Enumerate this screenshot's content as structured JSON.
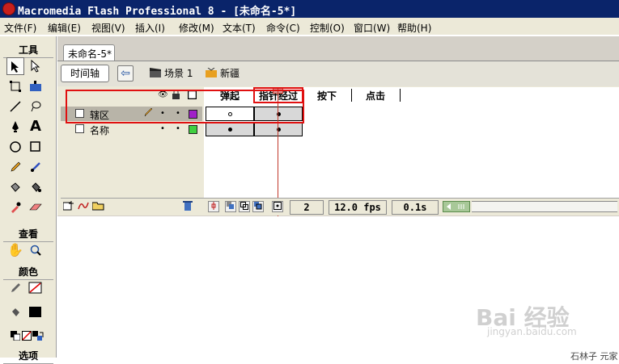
{
  "window": {
    "title": "Macromedia Flash Professional 8 - [未命名-5*]"
  },
  "menu": [
    "文件(F)",
    "编辑(E)",
    "视图(V)",
    "插入(I)",
    "修改(M)",
    "文本(T)",
    "命令(C)",
    "控制(O)",
    "窗口(W)",
    "帮助(H)"
  ],
  "tools": {
    "section_tools": "工具",
    "section_view": "查看",
    "section_colors": "颜色",
    "section_options": "选项"
  },
  "document": {
    "tab": "未命名-5*",
    "timeline_button": "时间轴",
    "scene": "场景 1",
    "symbol": "新疆"
  },
  "timeline": {
    "frame_headers": [
      "弹起",
      "指针经过",
      "按下",
      "点击"
    ],
    "layers": [
      {
        "name": "辖区",
        "selected": true,
        "color": "#a020c8"
      },
      {
        "name": "名称",
        "selected": false,
        "color": "#40d040"
      }
    ],
    "current_frame": "2",
    "fps": "12.0 fps",
    "time": "0.1s"
  },
  "watermark": {
    "text": "Bai 经验",
    "sub": "jingyan.baidu.com"
  },
  "corner": "石林子  元家"
}
